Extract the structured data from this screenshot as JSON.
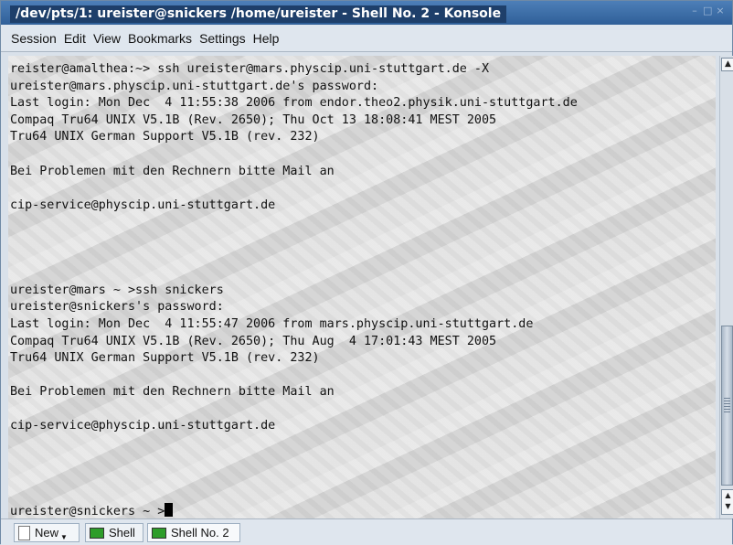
{
  "window": {
    "title": "/dev/pts/1: ureister@snickers /home/ureister - Shell No. 2 - Konsole",
    "buttons": [
      "minimize-icon",
      "maximize-icon",
      "close-icon"
    ]
  },
  "menu": {
    "items": [
      "Session",
      "Edit",
      "View",
      "Bookmarks",
      "Settings",
      "Help"
    ]
  },
  "terminal": {
    "lines": [
      "reister@amalthea:~> ssh ureister@mars.physcip.uni-stuttgart.de -X",
      "ureister@mars.physcip.uni-stuttgart.de's password:",
      "Last login: Mon Dec  4 11:55:38 2006 from endor.theo2.physik.uni-stuttgart.de",
      "Compaq Tru64 UNIX V5.1B (Rev. 2650); Thu Oct 13 18:08:41 MEST 2005",
      "Tru64 UNIX German Support V5.1B (rev. 232)",
      "",
      "Bei Problemen mit den Rechnern bitte Mail an",
      "",
      "cip-service@physcip.uni-stuttgart.de",
      "",
      "",
      "",
      "",
      "ureister@mars ~ >ssh snickers",
      "ureister@snickers's password:",
      "Last login: Mon Dec  4 11:55:47 2006 from mars.physcip.uni-stuttgart.de",
      "Compaq Tru64 UNIX V5.1B (Rev. 2650); Thu Aug  4 17:01:43 MEST 2005",
      "Tru64 UNIX German Support V5.1B (rev. 232)",
      "",
      "Bei Problemen mit den Rechnern bitte Mail an",
      "",
      "cip-service@physcip.uni-stuttgart.de",
      "",
      "",
      "",
      ""
    ],
    "prompt": "ureister@snickers ~ >"
  },
  "tabs": {
    "new_label": "New",
    "shell1_label": "Shell",
    "shell2_label": "Shell No. 2"
  }
}
